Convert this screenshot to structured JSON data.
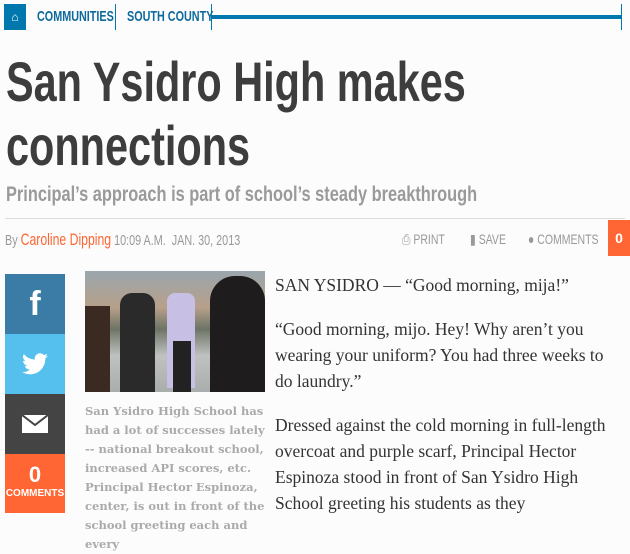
{
  "breadcrumb": {
    "items": [
      "COMMUNITIES",
      "SOUTH COUNTY"
    ]
  },
  "headline": {
    "line1": "San Ysidro High makes",
    "line2": "connections"
  },
  "dek": "Principal’s approach is part of school’s steady breakthrough",
  "byline": {
    "by": "By",
    "author": "Caroline Dipping",
    "time": "10:09 A.M.",
    "date": "JAN. 30, 2013"
  },
  "tools": {
    "print": "PRINT",
    "save": "SAVE",
    "comments": "COMMENTS",
    "count": "0"
  },
  "share": {
    "comment_count": "0",
    "comments_label": "COMMENTS"
  },
  "caption": "San Ysidro High School has had a lot of successes lately -- national breakout school, increased API scores, etc. Principal Hector Espinoza, center, is out in front of the school greeting each and every",
  "body": [
    "SAN YSIDRO — “Good morning, mija!”",
    "“Good morning, mijo. Hey! Why aren’t you wearing your uniform? You had three weeks to do laundry.”",
    "Dressed against the cold morning in full-length overcoat and purple scarf, Principal Hector Espinoza stood in front of San Ysidro High School greeting his students as they"
  ],
  "colors": {
    "accent": "#0077ad",
    "orange": "#ff6633",
    "facebook": "#3a7ca5",
    "twitter": "#55c0ee",
    "email": "#444444"
  }
}
